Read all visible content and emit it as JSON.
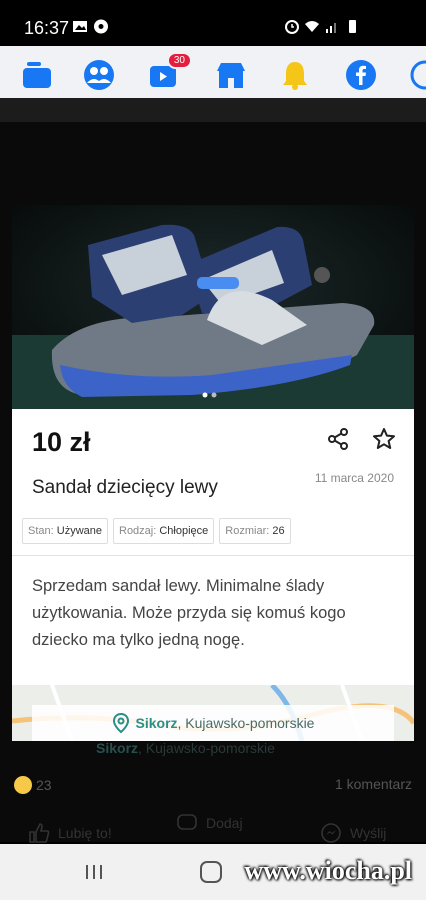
{
  "status_bar": {
    "time": "16:37"
  },
  "fb_nav": {
    "video_badge": "30"
  },
  "listing": {
    "price": "10 zł",
    "title": "Sandał dziecięcy lewy",
    "date": "11 marca 2020",
    "attributes": [
      {
        "label": "Stan:",
        "value": "Używane"
      },
      {
        "label": "Rodzaj:",
        "value": "Chłopięce"
      },
      {
        "label": "Rozmiar:",
        "value": "26"
      }
    ],
    "description": "Sprzedam sandał lewy. Minimalne ślady użytkowania. Może przyda się komuś kogo dziecko ma tylko jedną nogę.",
    "location_city": "Sikorz",
    "location_region": ", Kujawsko-pomorskie"
  },
  "post": {
    "reactions": "23",
    "comments": "1 komentarz",
    "like_label": "Lubię to!",
    "comment_label": "Dodaj",
    "send_label": "Wyślij"
  },
  "watermark": "www.wiocha.pl",
  "colors": {
    "fb_blue": "#1877f2",
    "map_teal": "#2a8f88"
  }
}
